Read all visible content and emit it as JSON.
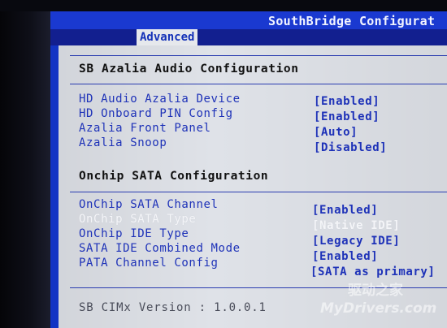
{
  "title": "SouthBridge Configurat",
  "tab": "Advanced",
  "sections": {
    "audio_heading": "SB Azalia Audio Configuration",
    "sata_heading": "Onchip SATA Configuration"
  },
  "audio_items": [
    {
      "label": "HD Audio Azalia Device",
      "value": "[Enabled]"
    },
    {
      "label": "HD Onboard PIN Config",
      "value": "[Enabled]"
    },
    {
      "label": "Azalia Front Panel",
      "value": "[Auto]"
    },
    {
      "label": "Azalia Snoop",
      "value": "[Disabled]"
    }
  ],
  "sata_items": [
    {
      "label": "OnChip SATA Channel",
      "value": "[Enabled]"
    },
    {
      "label": "OnChip SATA Type",
      "value": "[Native IDE]"
    },
    {
      "label": "OnChip IDE Type",
      "value": "[Legacy IDE]"
    },
    {
      "label": "SATA IDE Combined Mode",
      "value": "[Enabled]"
    },
    {
      "label": "PATA Channel Config",
      "value": "[SATA as primary]"
    }
  ],
  "footer": "SB CIMx Version : 1.0.0.1",
  "watermark": {
    "top": "驱动之家",
    "bottom": "MyDrivers.com"
  },
  "colors": {
    "bios_blue": "#1234c4",
    "panel_gray": "#dfe2e8",
    "item_blue": "#1e32b8"
  }
}
